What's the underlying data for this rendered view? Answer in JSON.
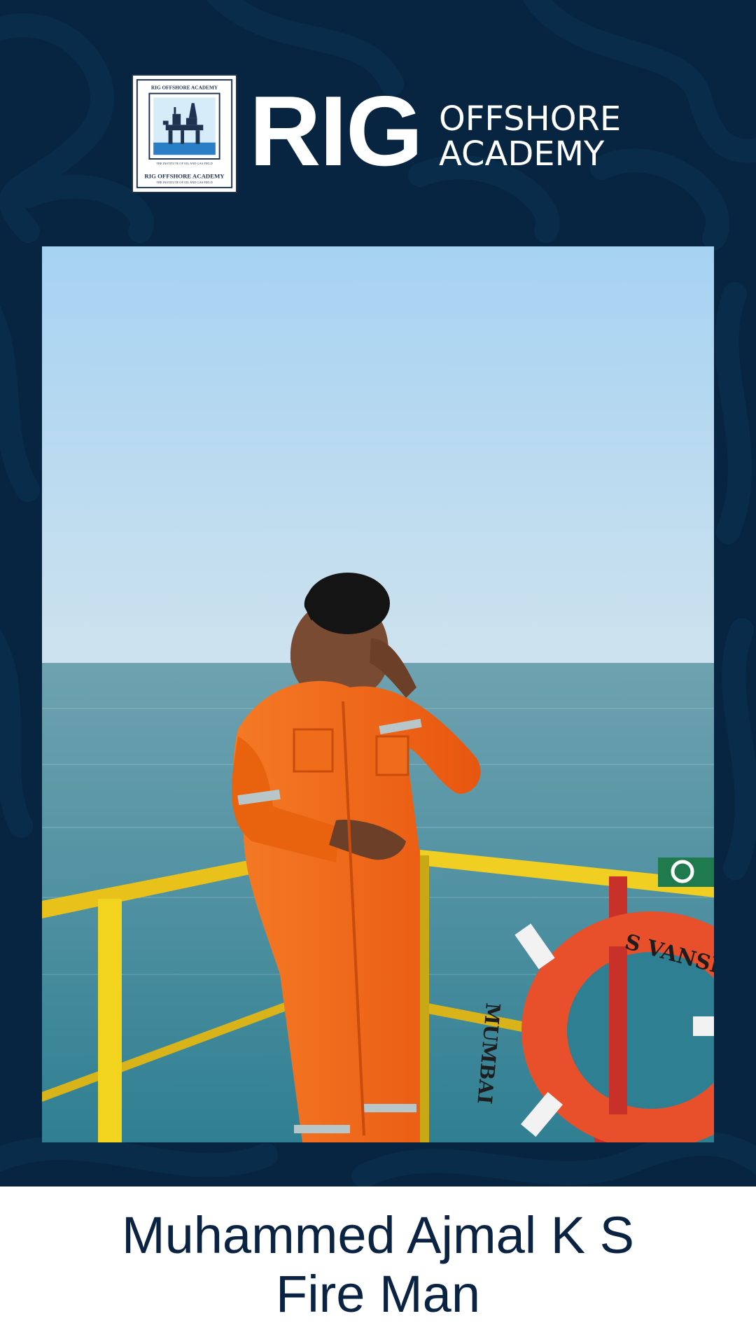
{
  "logo": {
    "badge_top_text": "RIG OFFSHORE ACADEMY",
    "badge_tagline": "THE INSTITUTE OF OIL AND GAS FIELD",
    "badge_bottom_text": "RIG OFFSHORE ACADEMY",
    "badge_bottom_tagline": "THE INSTITUTE OF OIL AND GAS FIELD",
    "wordmark": "RIG",
    "sub_line1": "OFFSHORE",
    "sub_line2": "ACADEMY"
  },
  "photo": {
    "lifebuoy_text_top": "S  VANSH",
    "lifebuoy_text_side": "MUMBAI"
  },
  "caption": {
    "name": "Muhammed Ajmal K S",
    "role": "Fire Man"
  },
  "colors": {
    "background": "#072541",
    "caption_text": "#0a2342",
    "coverall": "#f26a1b",
    "railing": "#f2d21e",
    "lifebuoy": "#e8502b"
  }
}
